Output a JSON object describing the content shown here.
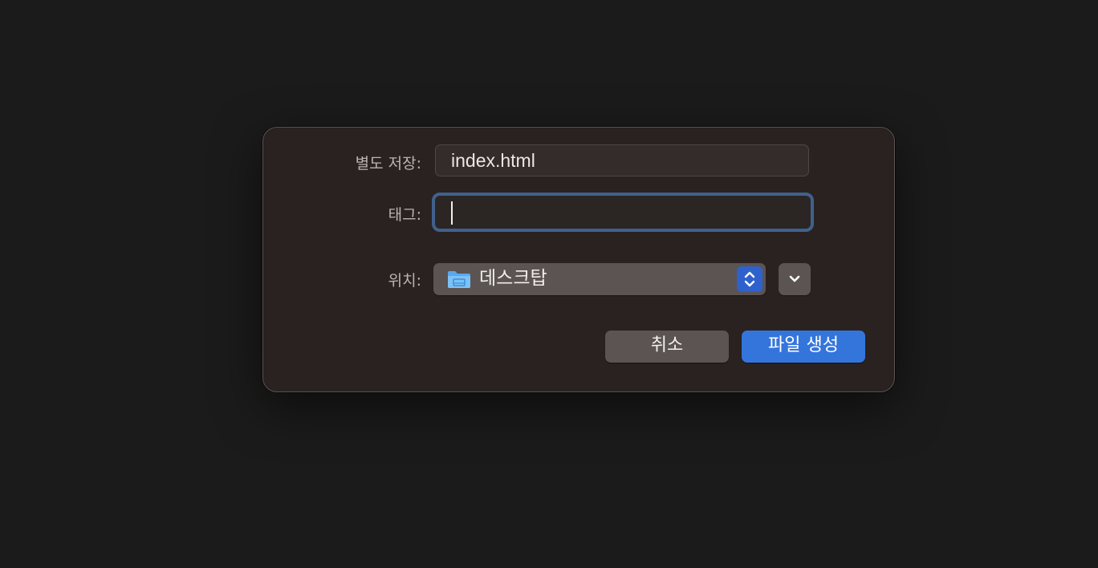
{
  "dialog": {
    "save_as": {
      "label": "별도 저장:",
      "value": "index.html"
    },
    "tags": {
      "label": "태그:",
      "value": ""
    },
    "where": {
      "label": "위치:",
      "selected": "데스크탑",
      "icon": "folder-icon"
    },
    "buttons": {
      "cancel": "취소",
      "create": "파일 생성"
    },
    "colors": {
      "accent": "#3475dc",
      "focus_ring": "#40618d",
      "folder": "#6ab6f2"
    }
  }
}
